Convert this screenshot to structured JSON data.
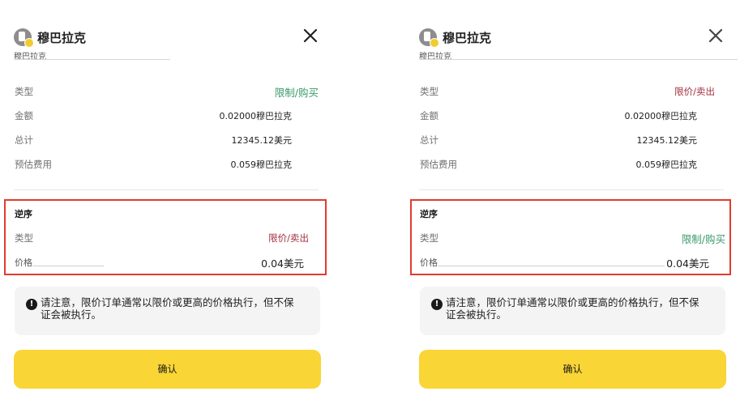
{
  "panels": [
    {
      "asset_name": "穆巴拉克",
      "asset_sub": "穆巴拉克",
      "type_label": "类型",
      "type_value": "限制/购买",
      "amount_label": "金额",
      "amount_value": "0.02000穆巴拉克",
      "total_label": "总计",
      "total_value": "12345.12美元",
      "fee_label": "预估费用",
      "fee_value": "0.059穆巴拉克",
      "reverse": {
        "title": "逆序",
        "type_label": "类型",
        "type_value": "限价/卖出",
        "price_label": "价格",
        "price_value": "0.04美元"
      },
      "notice_icon": "!",
      "notice_line1": "请注意，限价订单通常以限价或更高的价格执行，但不保",
      "notice_line2": "证会被执行。",
      "confirm_label": "确认"
    },
    {
      "asset_name": "穆巴拉克",
      "asset_sub": "穆巴拉克",
      "type_label": "类型",
      "type_value": "限价/卖出",
      "amount_label": "金额",
      "amount_value": "0.02000穆巴拉克",
      "total_label": "总计",
      "total_value": "12345.12美元",
      "fee_label": "预估费用",
      "fee_value": "0.059穆巴拉克",
      "reverse": {
        "title": "逆序",
        "type_label": "类型",
        "type_value": "限制/购买",
        "price_label": "价格",
        "price_value": "0.04美元"
      },
      "notice_icon": "!",
      "notice_line1": "请注意，限价订单通常以限价或更高的价格执行，但不保",
      "notice_line2": "证会被执行。",
      "confirm_label": "确认"
    }
  ],
  "colors": {
    "buy_green": "#3a9a6a",
    "sell_red": "#a33040",
    "highlight_border": "#e23b2e",
    "confirm_yellow": "#f9d535"
  },
  "icons": {
    "coin": "coin-icon",
    "close": "close-icon",
    "warning": "warning-icon"
  }
}
